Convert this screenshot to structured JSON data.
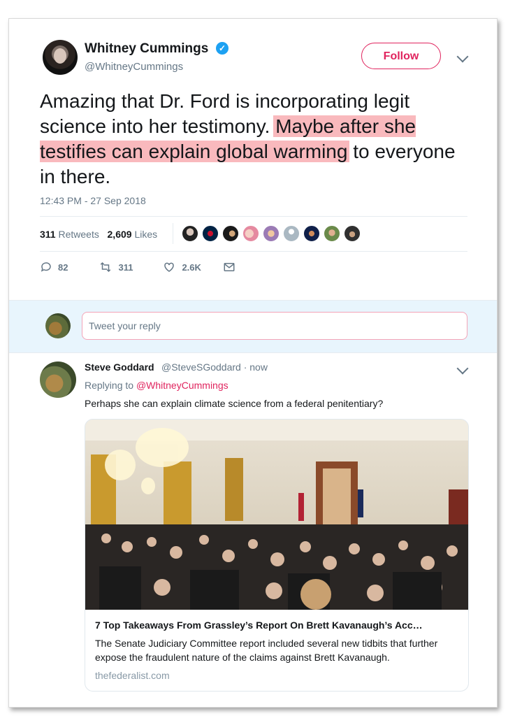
{
  "tweet": {
    "author_name": "Whitney Cummings",
    "handle": "@WhitneyCummings",
    "follow_label": "Follow",
    "text_part1": "Amazing that Dr. Ford is incorporating legit science into her testimony. ",
    "text_highlight": "Maybe after she testifies can explain global warming",
    "text_part2": " to everyone in there.",
    "timestamp": "12:43 PM - 27 Sep 2018",
    "retweets_count": "311",
    "retweets_label": "Retweets",
    "likes_count": "2,609",
    "likes_label": "Likes",
    "highlight_color": "#f9b9bd",
    "liker_avatar_count": 9
  },
  "actions": {
    "replies": "82",
    "retweets": "311",
    "likes": "2.6K"
  },
  "reply_box": {
    "placeholder": "Tweet your reply"
  },
  "reply": {
    "author_name": "Steve Goddard",
    "handle_time": "@SteveSGoddard · now",
    "replying_prefix": "Replying to",
    "replying_to": "@WhitneyCummings",
    "text": "Perhaps she can explain climate science from a federal penitentiary?",
    "link_card": {
      "title": "7 Top Takeaways From Grassley’s Report On Brett Kavanaugh’s Acc…",
      "description": "The Senate Judiciary Committee report included several new tidbits that further expose the fraudulent nature of the claims against Brett Kavanaugh.",
      "domain": "thefederalist.com"
    }
  },
  "colors": {
    "accent_red": "#e0245e",
    "verified_blue": "#1da1f2",
    "secondary_text": "#657786"
  }
}
